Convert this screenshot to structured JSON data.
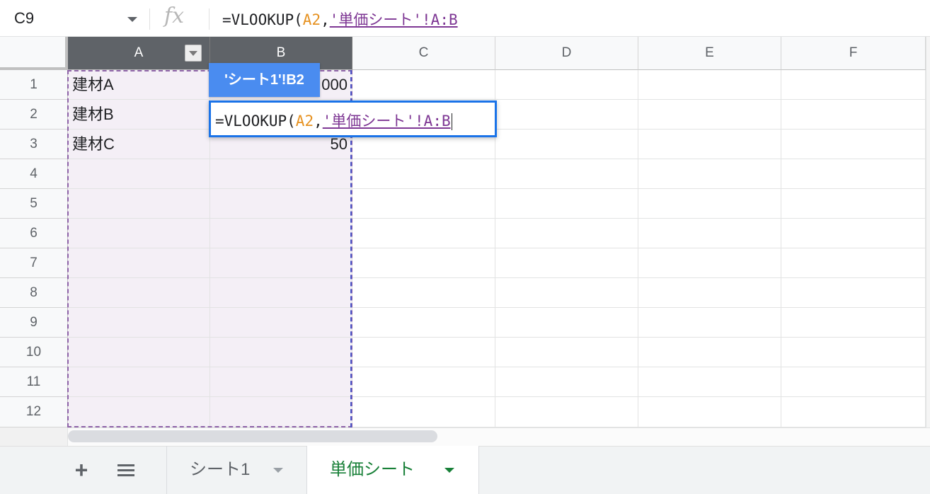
{
  "formula_bar": {
    "name_box": "C9",
    "fx_label": "fx",
    "formula_prefix": "=VLOOKUP(",
    "formula_ref_a2": "A2",
    "formula_comma": ",",
    "formula_ref_sheet": "'単価シート'!A:B"
  },
  "columns": [
    "A",
    "B",
    "C",
    "D",
    "E",
    "F"
  ],
  "rows": [
    "1",
    "2",
    "3",
    "4",
    "5",
    "6",
    "7",
    "8",
    "9",
    "10",
    "11",
    "12"
  ],
  "cells": {
    "A1": "建材A",
    "A2": "建材B",
    "A3": "建材C",
    "B1": "000",
    "B3": "50"
  },
  "tooltip": "'シート1'!B2",
  "editor": {
    "prefix": "=VLOOKUP(",
    "ref_a2": "A2",
    "comma": ",",
    "ref_sheet": "'単価シート'!A:B"
  },
  "sheet_tabs": [
    {
      "label": "シート1",
      "active": false
    },
    {
      "label": "単価シート",
      "active": true
    }
  ],
  "colors": {
    "ref_a2": "#e69222",
    "ref_sheet": "#7e3794",
    "active_tab": "#188038",
    "editor_border": "#1a73e8",
    "tooltip_bg": "#4a8cf0"
  }
}
